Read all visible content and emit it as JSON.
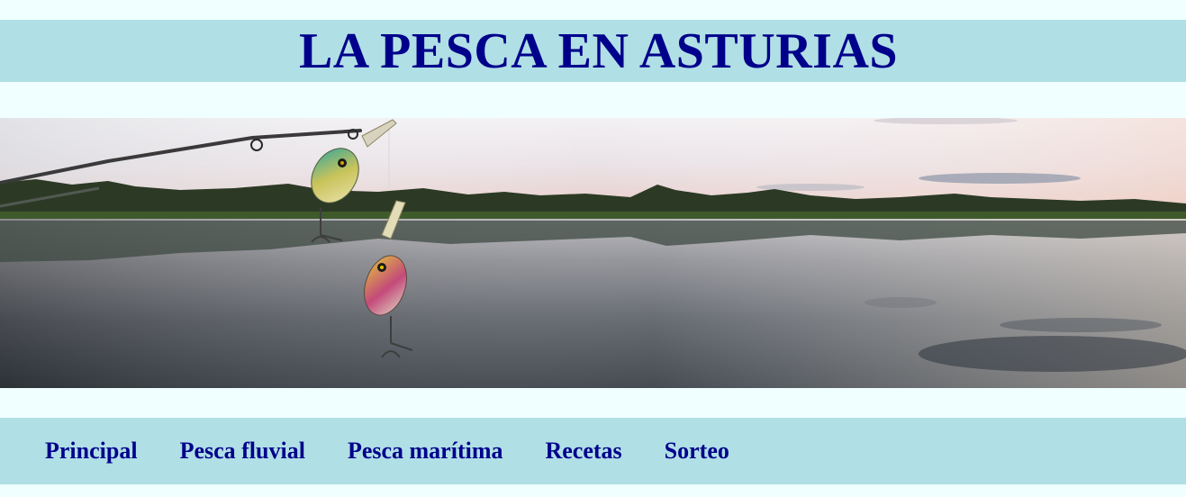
{
  "header": {
    "title": "LA PESCA EN ASTURIAS"
  },
  "banner": {
    "description_icon": "fishing-lure-lake-sunset-photo"
  },
  "nav": {
    "items": [
      {
        "label": "Principal"
      },
      {
        "label": "Pesca fluvial"
      },
      {
        "label": "Pesca marítima"
      },
      {
        "label": "Recetas"
      },
      {
        "label": "Sorteo"
      }
    ]
  },
  "colors": {
    "page_background": "#f0ffff",
    "bar_background": "#b0dfe6",
    "text": "#00008b"
  }
}
